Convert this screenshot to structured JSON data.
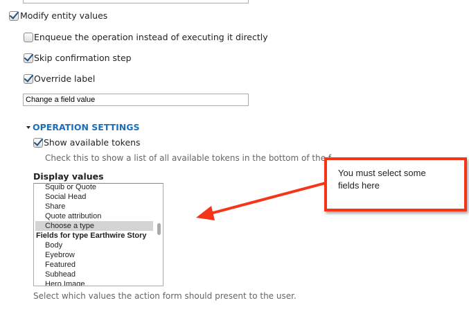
{
  "top_input_value": "",
  "modify_entity": {
    "label": "Modify entity values",
    "checked": true
  },
  "enqueue": {
    "label": "Enqueue the operation instead of executing it directly",
    "checked": false
  },
  "skip_confirmation": {
    "label": "Skip confirmation step",
    "checked": true
  },
  "override_label": {
    "label": "Override label",
    "checked": true,
    "value": "Change a field value"
  },
  "operation_settings": {
    "title": "OPERATION SETTINGS",
    "show_tokens": {
      "label": "Show available tokens",
      "checked": true,
      "help": "Check this to show a list of all available tokens in the bottom of the f"
    },
    "display_values": {
      "label": "Display values",
      "items": [
        "Squib or Quote",
        "Social Head",
        "Share",
        "Quote attribution",
        "Choose a type",
        "Fields for type Earthwire Story",
        "Body",
        "Eyebrow",
        "Featured",
        "Subhead",
        "Hero Image"
      ],
      "selected": "Choose a type",
      "group_header": "Fields for type Earthwire Story",
      "help": "Select which values the action form should present to the user."
    }
  },
  "annotation": {
    "text": "You must select some fields here",
    "color": "#f53419"
  }
}
